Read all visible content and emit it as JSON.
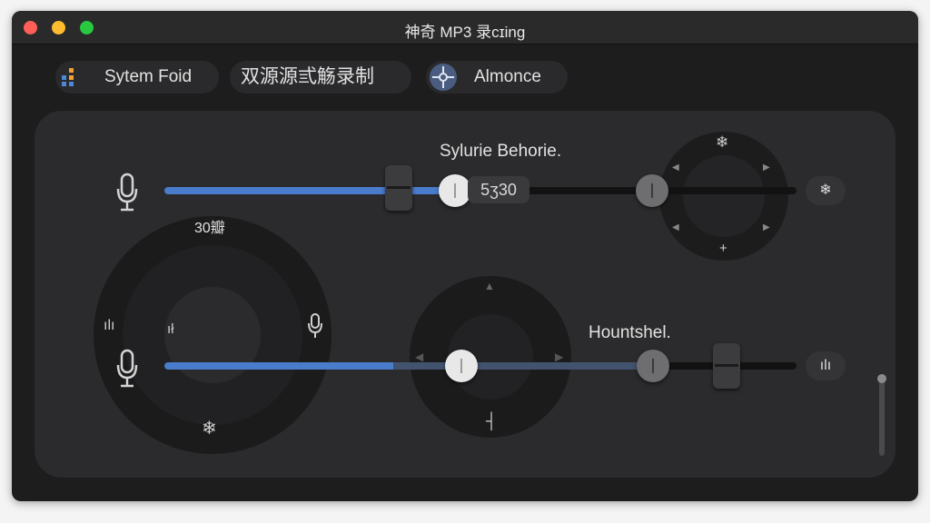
{
  "window": {
    "title": "神奇 MP3 录cɪing"
  },
  "toolbar": {
    "system_label": "Sytem Foid",
    "dual_label": "双源源弎觞录制",
    "almonce_label": "Almonce"
  },
  "panel": {
    "top_label": "Sylurie Behorie.",
    "value_readout": "5ʒ30",
    "left_dial_value": "30瓣",
    "bottom_label": "Hountshel.",
    "top_slider_level_pct": 46,
    "bottom_slider_level_pct": 47
  },
  "icons": {
    "dots": "◆",
    "mic": "🎙",
    "wave": "ılı",
    "snowflake": "❄",
    "arrow_up": "▲",
    "arrow_down": "▼",
    "arrow_left": "◀",
    "arrow_right": "▶",
    "plus": "+",
    "tick": "ıł",
    "cross": "┤"
  },
  "colors": {
    "close": "#ff5f57",
    "minimize": "#febc2e",
    "zoom": "#28c840",
    "accent": "#4a7ccc"
  }
}
